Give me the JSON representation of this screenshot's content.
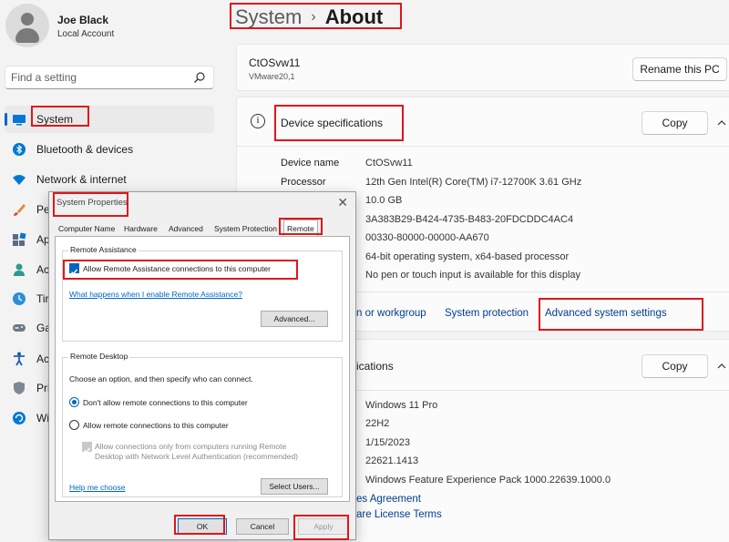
{
  "user": {
    "name": "Joe Black",
    "account_type": "Local Account"
  },
  "search": {
    "placeholder": "Find a setting"
  },
  "sidebar": {
    "items": [
      {
        "label": "System",
        "icon": "monitor-icon",
        "active": true
      },
      {
        "label": "Bluetooth & devices",
        "icon": "bluetooth-icon"
      },
      {
        "label": "Network & internet",
        "icon": "wifi-icon"
      },
      {
        "label": "Pe",
        "icon": "brush-icon"
      },
      {
        "label": "Ap",
        "icon": "apps-icon"
      },
      {
        "label": "Ac",
        "icon": "person-icon"
      },
      {
        "label": "Tir",
        "icon": "clock-icon"
      },
      {
        "label": "Ga",
        "icon": "gamepad-icon"
      },
      {
        "label": "Ac",
        "icon": "accessibility-icon"
      },
      {
        "label": "Pri",
        "icon": "shield-icon"
      },
      {
        "label": "Wi",
        "icon": "update-icon"
      }
    ]
  },
  "header": {
    "crumb": "System",
    "separator": "›",
    "current": "About"
  },
  "device": {
    "name": "CtOSvw11",
    "model": "VMware20,1",
    "rename_label": "Rename this PC"
  },
  "device_specs": {
    "title": "Device specifications",
    "copy_label": "Copy",
    "rows": [
      {
        "label": "Device name",
        "value": "CtOSvw11"
      },
      {
        "label": "Processor",
        "value": "12th Gen Intel(R) Core(TM) i7-12700K   3.61 GHz"
      },
      {
        "label": "",
        "value": "10.0 GB"
      },
      {
        "label": "",
        "value": "3A383B29-B424-4735-B483-20FDCDDC4AC4"
      },
      {
        "label": "",
        "value": "00330-80000-00000-AA670"
      },
      {
        "label": "",
        "value": "64-bit operating system, x64-based processor"
      },
      {
        "label": "",
        "value": "No pen or touch input is available for this display"
      }
    ]
  },
  "related_links": {
    "domain": "n or workgroup",
    "protection": "System protection",
    "advanced": "Advanced system settings"
  },
  "windows_specs": {
    "title": "ications",
    "copy_label": "Copy",
    "rows": [
      {
        "value": "Windows 11 Pro"
      },
      {
        "value": "22H2"
      },
      {
        "value": "1/15/2023"
      },
      {
        "value": "22621.1413"
      },
      {
        "value": "Windows Feature Experience Pack 1000.22639.1000.0"
      }
    ],
    "link1": "es Agreement",
    "link2": "are License Terms"
  },
  "dialog": {
    "title": "System Properties",
    "close": "✕",
    "tabs": [
      "Computer Name",
      "Hardware",
      "Advanced",
      "System Protection",
      "Remote"
    ],
    "active_tab": "Remote",
    "remote_assistance": {
      "label": "Remote Assistance",
      "checkbox_label": "Allow Remote Assistance connections to this computer",
      "checked": true,
      "help_link": "What happens when I enable Remote Assistance?",
      "advanced_label": "Advanced..."
    },
    "remote_desktop": {
      "label": "Remote Desktop",
      "description": "Choose an option, and then specify who can connect.",
      "option1": "Don't allow remote connections to this computer",
      "option2": "Allow remote connections to this computer",
      "nla_line1": "Allow connections only from computers running Remote",
      "nla_line2": "Desktop with Network Level Authentication (recommended)",
      "help_link": "Help me choose",
      "select_users_label": "Select Users..."
    },
    "ok_label": "OK",
    "cancel_label": "Cancel",
    "apply_label": "Apply"
  },
  "colors": {
    "accent": "#0067c0",
    "annotation": "#e0161b",
    "link": "#003e92"
  }
}
